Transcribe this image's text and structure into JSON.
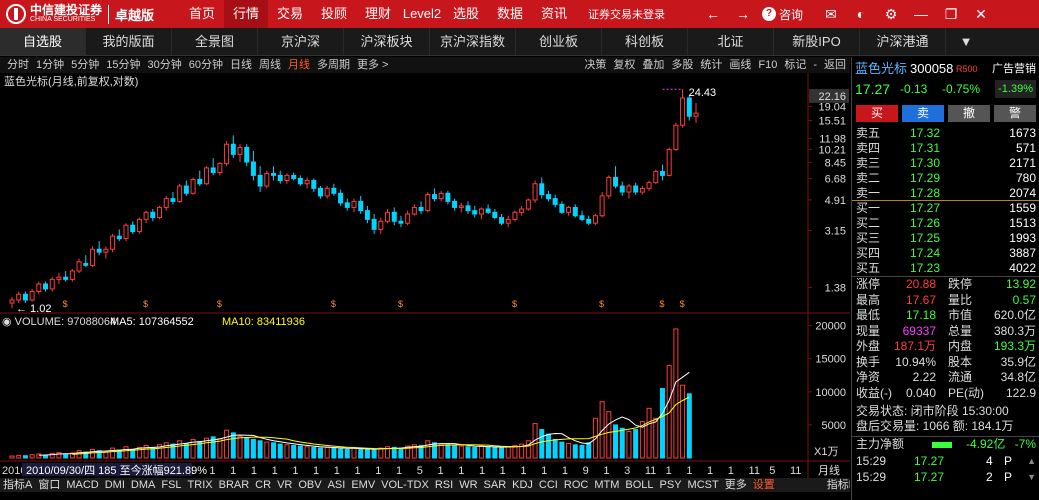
{
  "brand": {
    "name": "中信建投证券",
    "sub": "CHINA SECURITIES",
    "edition": "卓越版"
  },
  "top_nav": [
    "首页",
    "行情",
    "交易",
    "投顾",
    "理财",
    "Level2",
    "选股",
    "数据",
    "资讯"
  ],
  "top_nav_active": 1,
  "login_status": "证券交易未登录",
  "consult": "咨询",
  "market_tabs": [
    "自选股",
    "我的版面",
    "全景图",
    "京沪深",
    "沪深板块",
    "京沪深指数",
    "创业板",
    "科创板",
    "北证",
    "新股IPO",
    "沪深港通"
  ],
  "market_active": 0,
  "periods": [
    "分时",
    "1分钟",
    "5分钟",
    "15分钟",
    "30分钟",
    "60分钟",
    "日线",
    "周线",
    "月线",
    "多周期",
    "更多 >"
  ],
  "period_active": "月线",
  "tools": [
    "决策",
    "复权",
    "叠加",
    "多股",
    "统计",
    "画线",
    "F10",
    "标记",
    "-",
    "返回"
  ],
  "chart_title": "蓝色光标(月线,前复权,对数)",
  "chart_data": {
    "type": "candlestick",
    "scale": "log",
    "ylim": [
      0.98,
      24.5
    ],
    "price_ticks": [
      22.16,
      19.04,
      15.51,
      11.98,
      10.21,
      8.45,
      6.68,
      4.91,
      3.15,
      1.38
    ],
    "max_label": "24.43",
    "min_label": "1.02",
    "candles": [
      [
        1.1,
        1.2,
        1.02,
        1.15
      ],
      [
        1.15,
        1.3,
        1.1,
        1.25
      ],
      [
        1.25,
        1.3,
        1.1,
        1.15
      ],
      [
        1.15,
        1.35,
        1.12,
        1.3
      ],
      [
        1.3,
        1.5,
        1.25,
        1.45
      ],
      [
        1.45,
        1.5,
        1.3,
        1.35
      ],
      [
        1.35,
        1.6,
        1.3,
        1.55
      ],
      [
        1.55,
        1.7,
        1.45,
        1.6
      ],
      [
        1.6,
        1.75,
        1.5,
        1.55
      ],
      [
        1.55,
        1.8,
        1.5,
        1.75
      ],
      [
        1.75,
        2.1,
        1.7,
        2.0
      ],
      [
        1.95,
        2.2,
        1.85,
        1.9
      ],
      [
        1.9,
        2.5,
        1.85,
        2.4
      ],
      [
        2.4,
        2.7,
        2.2,
        2.3
      ],
      [
        2.3,
        2.5,
        2.1,
        2.4
      ],
      [
        2.4,
        3.0,
        2.3,
        2.9
      ],
      [
        2.9,
        3.2,
        2.7,
        2.8
      ],
      [
        2.8,
        3.5,
        2.7,
        3.4
      ],
      [
        3.4,
        3.6,
        3.0,
        3.1
      ],
      [
        3.1,
        3.8,
        3.0,
        3.7
      ],
      [
        3.7,
        4.2,
        3.5,
        4.1
      ],
      [
        4.1,
        4.3,
        3.6,
        3.8
      ],
      [
        3.8,
        4.5,
        3.7,
        4.4
      ],
      [
        4.4,
        5.2,
        4.2,
        5.0
      ],
      [
        5.0,
        5.5,
        4.6,
        4.8
      ],
      [
        4.8,
        6.2,
        4.7,
        6.0
      ],
      [
        6.0,
        6.5,
        5.2,
        5.4
      ],
      [
        5.4,
        6.8,
        5.3,
        6.6
      ],
      [
        6.6,
        7.5,
        6.0,
        6.2
      ],
      [
        6.2,
        8.0,
        6.1,
        7.8
      ],
      [
        7.8,
        9.0,
        7.0,
        7.3
      ],
      [
        7.3,
        8.5,
        7.0,
        8.3
      ],
      [
        8.3,
        11.5,
        8.0,
        11.0
      ],
      [
        11.0,
        12.5,
        9.0,
        9.5
      ],
      [
        9.5,
        11.0,
        8.5,
        10.5
      ],
      [
        10.5,
        11.0,
        8.0,
        8.5
      ],
      [
        8.5,
        10.0,
        6.5,
        7.0
      ],
      [
        7.0,
        8.0,
        5.5,
        6.0
      ],
      [
        6.0,
        7.5,
        5.8,
        7.2
      ],
      [
        7.2,
        8.0,
        6.5,
        7.0
      ],
      [
        7.0,
        7.5,
        6.2,
        6.5
      ],
      [
        6.5,
        7.2,
        6.2,
        7.0
      ],
      [
        7.0,
        7.3,
        6.5,
        6.7
      ],
      [
        6.7,
        7.0,
        6.0,
        6.2
      ],
      [
        6.2,
        6.8,
        5.8,
        6.5
      ],
      [
        6.5,
        6.7,
        5.5,
        5.8
      ],
      [
        5.8,
        6.0,
        5.0,
        5.2
      ],
      [
        5.2,
        6.0,
        5.0,
        5.8
      ],
      [
        5.8,
        6.2,
        5.2,
        5.4
      ],
      [
        5.4,
        5.7,
        4.5,
        4.7
      ],
      [
        4.7,
        5.0,
        4.2,
        4.4
      ],
      [
        4.4,
        5.0,
        4.1,
        4.8
      ],
      [
        4.8,
        5.2,
        4.0,
        4.2
      ],
      [
        4.2,
        4.5,
        3.5,
        3.7
      ],
      [
        3.7,
        4.0,
        3.0,
        3.2
      ],
      [
        3.2,
        3.8,
        3.0,
        3.6
      ],
      [
        3.6,
        4.3,
        3.5,
        4.1
      ],
      [
        4.1,
        4.4,
        3.4,
        3.6
      ],
      [
        3.6,
        3.9,
        3.3,
        3.5
      ],
      [
        3.5,
        4.2,
        3.4,
        4.0
      ],
      [
        4.0,
        4.6,
        3.9,
        4.4
      ],
      [
        4.4,
        4.8,
        4.0,
        4.2
      ],
      [
        4.2,
        5.5,
        4.1,
        5.3
      ],
      [
        5.3,
        5.8,
        4.8,
        5.0
      ],
      [
        5.0,
        5.6,
        4.8,
        5.4
      ],
      [
        5.4,
        5.6,
        4.6,
        4.8
      ],
      [
        4.8,
        5.0,
        4.2,
        4.4
      ],
      [
        4.4,
        4.7,
        4.1,
        4.5
      ],
      [
        4.5,
        4.8,
        4.0,
        4.2
      ],
      [
        4.2,
        4.5,
        3.8,
        4.0
      ],
      [
        4.0,
        4.4,
        3.7,
        4.3
      ],
      [
        4.3,
        4.6,
        4.0,
        4.1
      ],
      [
        4.1,
        4.3,
        3.7,
        3.8
      ],
      [
        3.8,
        4.0,
        3.4,
        3.5
      ],
      [
        3.5,
        3.9,
        3.3,
        3.7
      ],
      [
        3.7,
        4.2,
        3.6,
        4.1
      ],
      [
        4.1,
        4.5,
        3.9,
        4.3
      ],
      [
        4.3,
        5.0,
        4.2,
        4.9
      ],
      [
        4.9,
        6.5,
        4.7,
        6.2
      ],
      [
        6.2,
        6.8,
        5.0,
        5.3
      ],
      [
        5.3,
        5.6,
        4.8,
        5.0
      ],
      [
        5.0,
        5.3,
        4.4,
        4.6
      ],
      [
        4.6,
        4.8,
        4.0,
        4.1
      ],
      [
        4.1,
        4.5,
        3.9,
        4.4
      ],
      [
        4.4,
        4.6,
        3.8,
        3.9
      ],
      [
        3.9,
        4.2,
        3.6,
        3.7
      ],
      [
        3.7,
        3.9,
        3.4,
        3.5
      ],
      [
        3.5,
        4.0,
        3.4,
        3.9
      ],
      [
        3.9,
        5.5,
        3.8,
        5.2
      ],
      [
        5.2,
        7.0,
        5.0,
        6.8
      ],
      [
        6.8,
        8.0,
        5.8,
        6.0
      ],
      [
        6.0,
        6.4,
        5.2,
        5.5
      ],
      [
        5.5,
        6.2,
        5.0,
        6.0
      ],
      [
        6.0,
        6.3,
        5.3,
        5.5
      ],
      [
        5.5,
        6.0,
        5.3,
        5.8
      ],
      [
        5.8,
        6.5,
        5.6,
        6.3
      ],
      [
        6.3,
        7.6,
        6.2,
        7.4
      ],
      [
        7.4,
        8.2,
        6.5,
        7.0
      ],
      [
        7.0,
        10.5,
        6.9,
        10.2
      ],
      [
        10.2,
        15.0,
        10.0,
        14.5
      ],
      [
        14.5,
        24.43,
        14.0,
        21.5
      ],
      [
        21.5,
        22.5,
        15.5,
        16.5
      ],
      [
        16.5,
        20.0,
        15.0,
        17.27
      ]
    ],
    "volume": [
      300,
      400,
      350,
      500,
      600,
      450,
      700,
      800,
      600,
      750,
      1100,
      900,
      1300,
      1100,
      900,
      1500,
      1200,
      1700,
      1300,
      1600,
      1900,
      1500,
      2000,
      2300,
      2100,
      2600,
      2200,
      2800,
      2500,
      3000,
      3200,
      2900,
      4200,
      3800,
      3300,
      3000,
      2800,
      2600,
      2400,
      2300,
      2100,
      2000,
      1900,
      1800,
      1700,
      1600,
      1500,
      1600,
      1500,
      1400,
      1300,
      1500,
      1400,
      1300,
      1200,
      1500,
      1700,
      1600,
      1500,
      1800,
      2000,
      1900,
      2600,
      2300,
      2100,
      2000,
      1900,
      1800,
      1700,
      1600,
      1800,
      1700,
      1600,
      1500,
      1700,
      1900,
      2100,
      2600,
      5200,
      4300,
      3600,
      2800,
      2400,
      2200,
      2000,
      1900,
      2300,
      6000,
      8500,
      7000,
      5000,
      4500,
      4000,
      4300,
      5500,
      7500,
      6000,
      10500,
      14000,
      19500,
      11000,
      9700
    ],
    "vol_ticks": [
      20000,
      15000,
      10000,
      5000
    ],
    "vol_unit": "X1万",
    "volume_legend": {
      "label": "VOLUME:",
      "value": "97088064",
      "ma5_label": "MA5:",
      "ma5": "107364552",
      "ma10_label": "MA10:",
      "ma10": "83411936"
    },
    "x_labels": [
      "2010",
      "10",
      "1",
      "4",
      "7",
      "1",
      "1",
      "1",
      "1",
      "1",
      "1",
      "1",
      "1",
      "1",
      "1",
      "1",
      "1",
      "1",
      "1",
      "1",
      "5",
      "1",
      "1",
      "1",
      "1",
      "1",
      "1",
      "1",
      "9",
      "1",
      "3",
      "11",
      "1",
      "1",
      "1",
      "1",
      "11",
      "5",
      "11"
    ],
    "info_bar": "2010/09/30/四 185 至今涨幅921.89%",
    "period_label": "月线",
    "colors": {
      "up": "#ff3b3b",
      "down": "#00d4ff",
      "ma5": "#ffffff",
      "ma10": "#ffff00",
      "purple": "#ff3bff"
    }
  },
  "stock": {
    "name": "蓝色光标",
    "code": "300058",
    "badge": "R500",
    "ad": "广告营销",
    "ad_pct": "-1.39%",
    "price": "17.27",
    "change": "-0.13",
    "pct": "-0.75%"
  },
  "buttons": [
    {
      "label": "买",
      "bg": "#c8161d"
    },
    {
      "label": "卖",
      "bg": "#1e6fd9"
    },
    {
      "label": "撤",
      "bg": "#555"
    },
    {
      "label": "警",
      "bg": "#555"
    }
  ],
  "orderbook": {
    "sell": [
      {
        "label": "卖五",
        "price": "17.32",
        "vol": "1673"
      },
      {
        "label": "卖四",
        "price": "17.31",
        "vol": "571"
      },
      {
        "label": "卖三",
        "price": "17.30",
        "vol": "2171"
      },
      {
        "label": "卖二",
        "price": "17.29",
        "vol": "780"
      },
      {
        "label": "卖一",
        "price": "17.28",
        "vol": "2074"
      }
    ],
    "buy": [
      {
        "label": "买一",
        "price": "17.27",
        "vol": "1559"
      },
      {
        "label": "买二",
        "price": "17.26",
        "vol": "1513"
      },
      {
        "label": "买三",
        "price": "17.25",
        "vol": "1993"
      },
      {
        "label": "买四",
        "price": "17.24",
        "vol": "3887"
      },
      {
        "label": "买五",
        "price": "17.23",
        "vol": "4022"
      }
    ]
  },
  "stats": [
    {
      "l1": "涨停",
      "v1": "20.88",
      "c1": "#ff3b3b",
      "l2": "跌停",
      "v2": "13.92",
      "c2": "#3bff3b"
    },
    {
      "l1": "最高",
      "v1": "17.67",
      "c1": "#ff3b3b",
      "l2": "量比",
      "v2": "0.57",
      "c2": "#3bff3b"
    },
    {
      "l1": "最低",
      "v1": "17.18",
      "c1": "#3bff3b",
      "l2": "市值",
      "v2": "620.0亿",
      "c2": "#ddd"
    },
    {
      "l1": "现量",
      "v1": "69337",
      "c1": "#ff3bff",
      "l2": "总量",
      "v2": "380.3万",
      "c2": "#ddd"
    },
    {
      "l1": "外盘",
      "v1": "187.1万",
      "c1": "#ff3b3b",
      "l2": "内盘",
      "v2": "193.3万",
      "c2": "#3bff3b"
    },
    {
      "l1": "换手",
      "v1": "10.94%",
      "c1": "#ddd",
      "l2": "股本",
      "v2": "35.9亿",
      "c2": "#ddd"
    },
    {
      "l1": "净资",
      "v1": "2.22",
      "c1": "#ddd",
      "l2": "流通",
      "v2": "34.8亿",
      "c2": "#ddd"
    },
    {
      "l1": "收益(-)",
      "v1": "0.040",
      "c1": "#ddd",
      "l2": "PE(动)",
      "v2": "122.9",
      "c2": "#ddd"
    }
  ],
  "trade_status": "交易状态: 闭市阶段 15:30:00",
  "after_hours": "盘后交易量: 1066  额: 184.1万",
  "main_flow": {
    "label": "主力净额",
    "value": "-4.92亿",
    "pct": "-7%"
  },
  "ticks": [
    {
      "time": "15:29",
      "price": "17.27",
      "vol": "4",
      "dir": "P"
    },
    {
      "time": "15:29",
      "price": "17.27",
      "vol": "2",
      "dir": "P"
    }
  ],
  "bottom_tabs": [
    "指标A",
    "窗口",
    "MACD",
    "DMI",
    "DMA",
    "FSL",
    "TRIX",
    "BRAR",
    "CR",
    "VR",
    "OBV",
    "ASI",
    "EMV",
    "VOL-TDX",
    "RSI",
    "WR",
    "SAR",
    "KDJ",
    "CCI",
    "ROC",
    "MTM",
    "BOLL",
    "PSY",
    "MCST",
    "更多",
    "设置"
  ],
  "bottom_right": [
    "指标B",
    "模板"
  ]
}
